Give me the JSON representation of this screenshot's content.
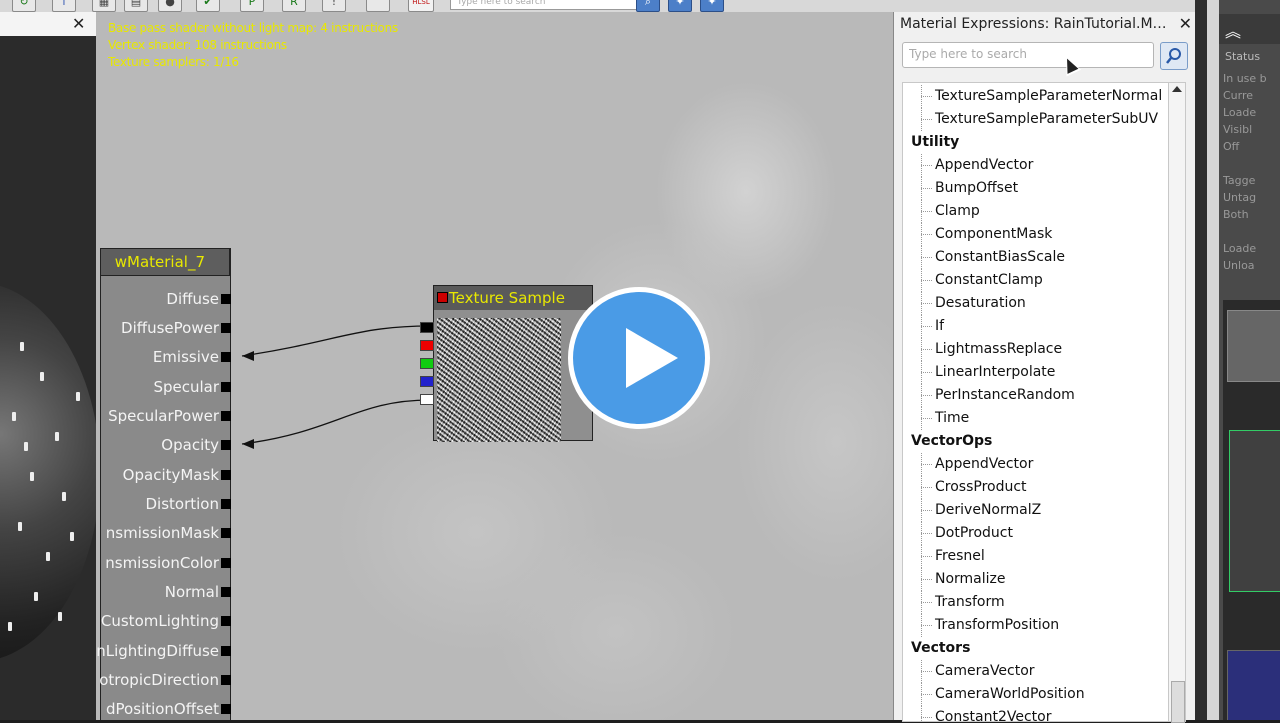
{
  "toolbar": {
    "search_placeholder": "Type here to search",
    "hlsl_label": "HLSL"
  },
  "preview": {
    "close_glyph": "✕"
  },
  "canvas": {
    "stats": [
      "Base pass shader without light map: 4 instructions",
      "Vertex shader: 108 instructions",
      "Texture samplers: 1/16"
    ]
  },
  "material_node": {
    "title": "wMaterial_7",
    "inputs": [
      "Diffuse",
      "DiffusePower",
      "Emissive",
      "Specular",
      "SpecularPower",
      "Opacity",
      "OpacityMask",
      "Distortion",
      "nsmissionMask",
      "nsmissionColor",
      "Normal",
      "CustomLighting",
      "nLightingDiffuse",
      "otropicDirection",
      "dPositionOffset"
    ]
  },
  "texture_node": {
    "title": "Texture Sample"
  },
  "expressions_panel": {
    "title": "Material Expressions: RainTutorial.Materia...",
    "close_glyph": "✕",
    "search_placeholder": "Type here to search",
    "tree": [
      {
        "type": "leaf",
        "label": "TextureSampleParameterNormal"
      },
      {
        "type": "leaf",
        "label": "TextureSampleParameterSubUV"
      },
      {
        "type": "cat",
        "label": "Utility"
      },
      {
        "type": "leaf",
        "label": "AppendVector"
      },
      {
        "type": "leaf",
        "label": "BumpOffset"
      },
      {
        "type": "leaf",
        "label": "Clamp"
      },
      {
        "type": "leaf",
        "label": "ComponentMask"
      },
      {
        "type": "leaf",
        "label": "ConstantBiasScale"
      },
      {
        "type": "leaf",
        "label": "ConstantClamp"
      },
      {
        "type": "leaf",
        "label": "Desaturation"
      },
      {
        "type": "leaf",
        "label": "If"
      },
      {
        "type": "leaf",
        "label": "LightmassReplace"
      },
      {
        "type": "leaf",
        "label": "LinearInterpolate"
      },
      {
        "type": "leaf",
        "label": "PerInstanceRandom"
      },
      {
        "type": "leaf",
        "label": "Time"
      },
      {
        "type": "cat",
        "label": "VectorOps"
      },
      {
        "type": "leaf",
        "label": "AppendVector"
      },
      {
        "type": "leaf",
        "label": "CrossProduct"
      },
      {
        "type": "leaf",
        "label": "DeriveNormalZ"
      },
      {
        "type": "leaf",
        "label": "DotProduct"
      },
      {
        "type": "leaf",
        "label": "Fresnel"
      },
      {
        "type": "leaf",
        "label": "Normalize"
      },
      {
        "type": "leaf",
        "label": "Transform"
      },
      {
        "type": "leaf",
        "label": "TransformPosition"
      },
      {
        "type": "cat",
        "label": "Vectors"
      },
      {
        "type": "leaf",
        "label": "CameraVector"
      },
      {
        "type": "leaf",
        "label": "CameraWorldPosition"
      },
      {
        "type": "leaf",
        "label": "Constant2Vector"
      }
    ]
  },
  "side_panel": {
    "collapse_glyph": "︽",
    "status_label": "Status",
    "items": [
      "In use b",
      "Curre",
      "Loade",
      "Visibl",
      "Off",
      "",
      "Tagge",
      "Untag",
      "Both",
      "",
      "Loade",
      "Unloa"
    ]
  },
  "colors": {
    "stats_text": "#e8e800",
    "node_title_text": "#e8e800",
    "play_button": "#4a9be6",
    "canvas_bg": "#b9b9b9"
  },
  "icons": {
    "play": "play-icon",
    "search": "magnifier-icon",
    "close": "close-icon",
    "collapse": "chevron-up-double-icon"
  }
}
